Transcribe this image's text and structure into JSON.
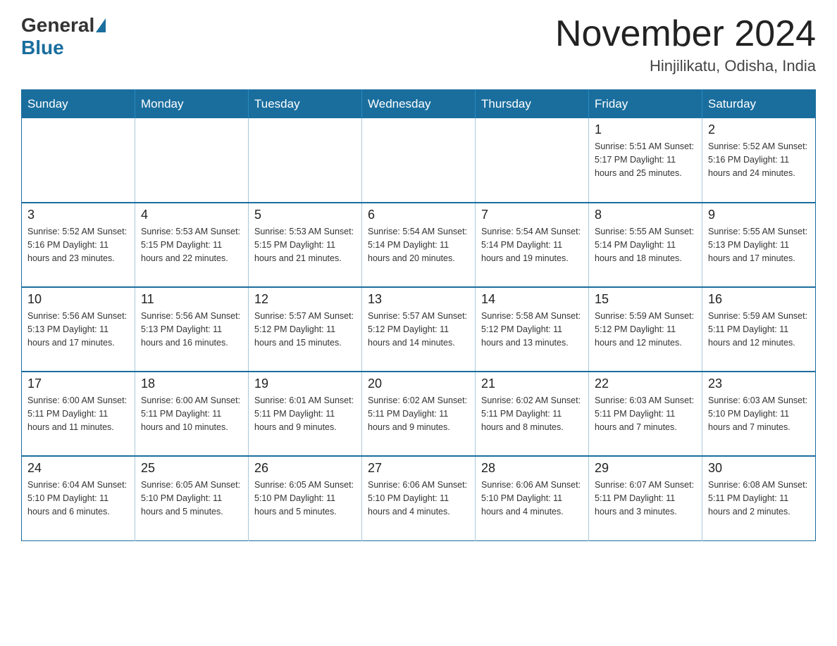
{
  "header": {
    "logo_general": "General",
    "logo_blue": "Blue",
    "month_title": "November 2024",
    "location": "Hinjilikatu, Odisha, India"
  },
  "weekdays": [
    "Sunday",
    "Monday",
    "Tuesday",
    "Wednesday",
    "Thursday",
    "Friday",
    "Saturday"
  ],
  "weeks": [
    [
      {
        "day": "",
        "info": ""
      },
      {
        "day": "",
        "info": ""
      },
      {
        "day": "",
        "info": ""
      },
      {
        "day": "",
        "info": ""
      },
      {
        "day": "",
        "info": ""
      },
      {
        "day": "1",
        "info": "Sunrise: 5:51 AM\nSunset: 5:17 PM\nDaylight: 11 hours and 25 minutes."
      },
      {
        "day": "2",
        "info": "Sunrise: 5:52 AM\nSunset: 5:16 PM\nDaylight: 11 hours and 24 minutes."
      }
    ],
    [
      {
        "day": "3",
        "info": "Sunrise: 5:52 AM\nSunset: 5:16 PM\nDaylight: 11 hours and 23 minutes."
      },
      {
        "day": "4",
        "info": "Sunrise: 5:53 AM\nSunset: 5:15 PM\nDaylight: 11 hours and 22 minutes."
      },
      {
        "day": "5",
        "info": "Sunrise: 5:53 AM\nSunset: 5:15 PM\nDaylight: 11 hours and 21 minutes."
      },
      {
        "day": "6",
        "info": "Sunrise: 5:54 AM\nSunset: 5:14 PM\nDaylight: 11 hours and 20 minutes."
      },
      {
        "day": "7",
        "info": "Sunrise: 5:54 AM\nSunset: 5:14 PM\nDaylight: 11 hours and 19 minutes."
      },
      {
        "day": "8",
        "info": "Sunrise: 5:55 AM\nSunset: 5:14 PM\nDaylight: 11 hours and 18 minutes."
      },
      {
        "day": "9",
        "info": "Sunrise: 5:55 AM\nSunset: 5:13 PM\nDaylight: 11 hours and 17 minutes."
      }
    ],
    [
      {
        "day": "10",
        "info": "Sunrise: 5:56 AM\nSunset: 5:13 PM\nDaylight: 11 hours and 17 minutes."
      },
      {
        "day": "11",
        "info": "Sunrise: 5:56 AM\nSunset: 5:13 PM\nDaylight: 11 hours and 16 minutes."
      },
      {
        "day": "12",
        "info": "Sunrise: 5:57 AM\nSunset: 5:12 PM\nDaylight: 11 hours and 15 minutes."
      },
      {
        "day": "13",
        "info": "Sunrise: 5:57 AM\nSunset: 5:12 PM\nDaylight: 11 hours and 14 minutes."
      },
      {
        "day": "14",
        "info": "Sunrise: 5:58 AM\nSunset: 5:12 PM\nDaylight: 11 hours and 13 minutes."
      },
      {
        "day": "15",
        "info": "Sunrise: 5:59 AM\nSunset: 5:12 PM\nDaylight: 11 hours and 12 minutes."
      },
      {
        "day": "16",
        "info": "Sunrise: 5:59 AM\nSunset: 5:11 PM\nDaylight: 11 hours and 12 minutes."
      }
    ],
    [
      {
        "day": "17",
        "info": "Sunrise: 6:00 AM\nSunset: 5:11 PM\nDaylight: 11 hours and 11 minutes."
      },
      {
        "day": "18",
        "info": "Sunrise: 6:00 AM\nSunset: 5:11 PM\nDaylight: 11 hours and 10 minutes."
      },
      {
        "day": "19",
        "info": "Sunrise: 6:01 AM\nSunset: 5:11 PM\nDaylight: 11 hours and 9 minutes."
      },
      {
        "day": "20",
        "info": "Sunrise: 6:02 AM\nSunset: 5:11 PM\nDaylight: 11 hours and 9 minutes."
      },
      {
        "day": "21",
        "info": "Sunrise: 6:02 AM\nSunset: 5:11 PM\nDaylight: 11 hours and 8 minutes."
      },
      {
        "day": "22",
        "info": "Sunrise: 6:03 AM\nSunset: 5:11 PM\nDaylight: 11 hours and 7 minutes."
      },
      {
        "day": "23",
        "info": "Sunrise: 6:03 AM\nSunset: 5:10 PM\nDaylight: 11 hours and 7 minutes."
      }
    ],
    [
      {
        "day": "24",
        "info": "Sunrise: 6:04 AM\nSunset: 5:10 PM\nDaylight: 11 hours and 6 minutes."
      },
      {
        "day": "25",
        "info": "Sunrise: 6:05 AM\nSunset: 5:10 PM\nDaylight: 11 hours and 5 minutes."
      },
      {
        "day": "26",
        "info": "Sunrise: 6:05 AM\nSunset: 5:10 PM\nDaylight: 11 hours and 5 minutes."
      },
      {
        "day": "27",
        "info": "Sunrise: 6:06 AM\nSunset: 5:10 PM\nDaylight: 11 hours and 4 minutes."
      },
      {
        "day": "28",
        "info": "Sunrise: 6:06 AM\nSunset: 5:10 PM\nDaylight: 11 hours and 4 minutes."
      },
      {
        "day": "29",
        "info": "Sunrise: 6:07 AM\nSunset: 5:11 PM\nDaylight: 11 hours and 3 minutes."
      },
      {
        "day": "30",
        "info": "Sunrise: 6:08 AM\nSunset: 5:11 PM\nDaylight: 11 hours and 2 minutes."
      }
    ]
  ]
}
